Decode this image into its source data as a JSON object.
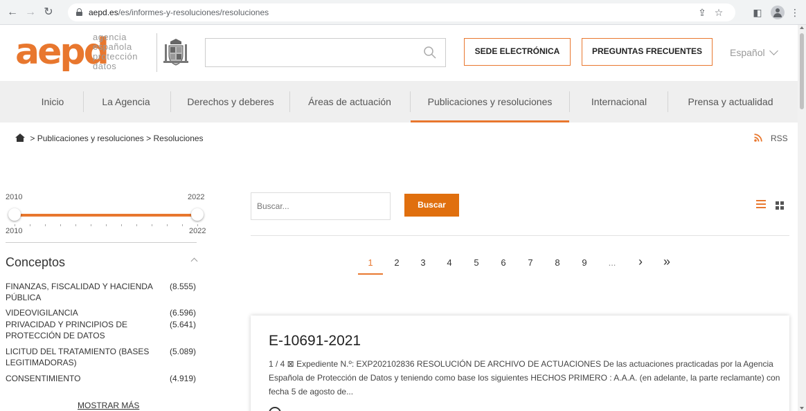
{
  "browser": {
    "url_host": "aepd.es",
    "url_path": "/es/informes-y-resoluciones/resoluciones",
    "back_icon": "arrow-left",
    "forward_icon": "arrow-right",
    "reload_icon": "reload",
    "share_icon": "share",
    "bookmark_icon": "star",
    "sidepanel_icon": "side-panel",
    "menu_icon": "kebab"
  },
  "header": {
    "logo_mark": "aepd",
    "logo_words": [
      "agencia",
      "española",
      "protección",
      "datos"
    ],
    "search_placeholder": "",
    "sede_label": "SEDE ELECTRÓNICA",
    "faq_label": "PREGUNTAS FRECUENTES",
    "language": "Español"
  },
  "nav": {
    "items": [
      {
        "label": "Inicio"
      },
      {
        "label": "La Agencia"
      },
      {
        "label": "Derechos y deberes"
      },
      {
        "label": "Áreas de actuación"
      },
      {
        "label": "Publicaciones y resoluciones",
        "active": true
      },
      {
        "label": "Internacional"
      },
      {
        "label": "Prensa y actualidad"
      }
    ]
  },
  "breadcrumb": {
    "items": [
      "Publicaciones y resoluciones",
      "Resoluciones"
    ],
    "separator": ">",
    "rss_label": "RSS"
  },
  "slider": {
    "min_label": "2010",
    "max_label": "2022",
    "from": 2010,
    "to": 2022
  },
  "concepts": {
    "title": "Conceptos",
    "items": [
      {
        "name": "FINANZAS, FISCALIDAD Y HACIENDA PÚBLICA",
        "count": "(8.555)"
      },
      {
        "name": "VIDEOVIGILANCIA",
        "count": "(6.596)"
      },
      {
        "name": "PRIVACIDAD Y PRINCIPIOS DE PROTECCIÓN DE DATOS",
        "count": "(5.641)"
      },
      {
        "name": "LICITUD DEL TRATAMIENTO (BASES LEGITIMADORAS)",
        "count": "(5.089)"
      },
      {
        "name": "CONSENTIMIENTO",
        "count": "(4.919)"
      }
    ],
    "show_more": "MOSTRAR MÁS"
  },
  "search": {
    "placeholder": "Buscar...",
    "button": "Buscar"
  },
  "pagination": {
    "pages": [
      "1",
      "2",
      "3",
      "4",
      "5",
      "6",
      "7",
      "8",
      "9"
    ],
    "current": "1",
    "ellipsis": "...",
    "next": "›",
    "last": "»"
  },
  "result": {
    "title": "E-10691-2021",
    "summary": "1 / 4 ⊠ Expediente N.º: EXP202102836 RESOLUCIÓN DE ARCHIVO DE ACTUACIONES De las actuaciones practicadas por la Agencia Española de Protección de Datos y teniendo como base los siguientes HECHOS PRIMERO : A.A.A. (en adelante, la parte reclamante) con fecha 5 de agosto de..."
  },
  "colors": {
    "accent": "#e8772e",
    "button": "#e06f0e",
    "nav_bg": "#efefef"
  }
}
